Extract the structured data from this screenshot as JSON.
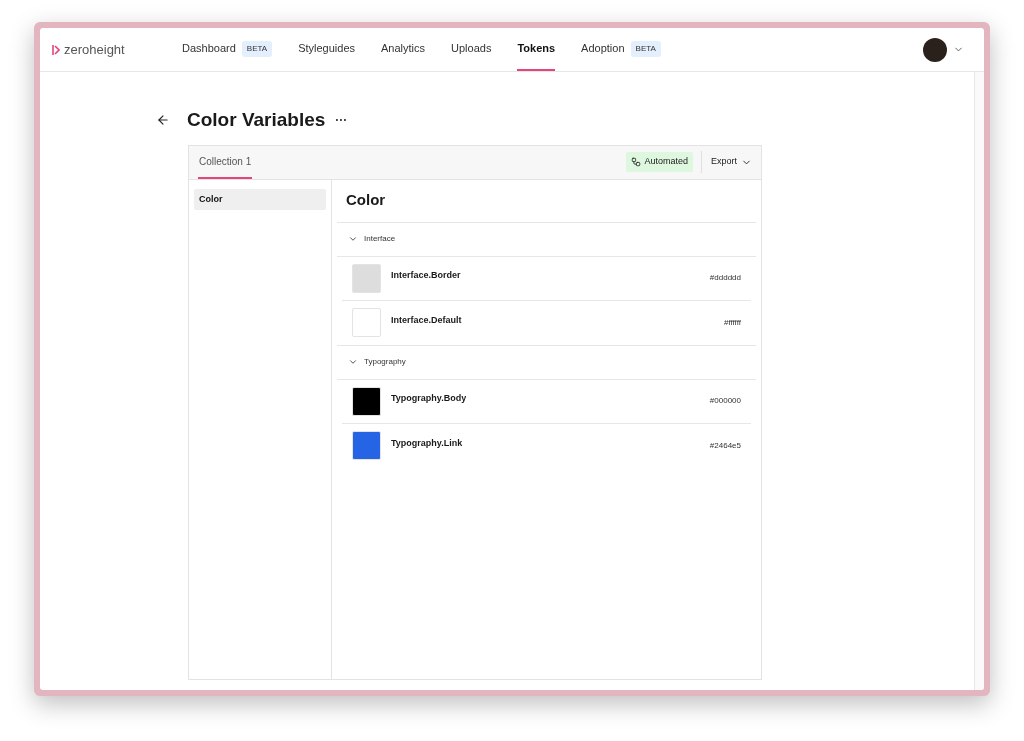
{
  "brand": "zeroheight",
  "nav": [
    {
      "label": "Dashboard",
      "badge": "BETA",
      "selected": false
    },
    {
      "label": "Styleguides",
      "selected": false
    },
    {
      "label": "Analytics",
      "selected": false
    },
    {
      "label": "Uploads",
      "selected": false
    },
    {
      "label": "Tokens",
      "selected": true
    },
    {
      "label": "Adoption",
      "badge": "BETA",
      "selected": false
    }
  ],
  "page_title": "Color Variables",
  "more": "···",
  "collection_tabs": [
    {
      "label": "Collection 1",
      "selected": true
    }
  ],
  "automated_badge": "Automated",
  "export_button": "Export",
  "sidebar": {
    "items": [
      {
        "label": "Color",
        "selected": true
      }
    ]
  },
  "section_title": "Color",
  "groups": [
    {
      "name": "Interface",
      "expanded": true,
      "tokens": [
        {
          "name": "Interface.Border",
          "value": "#dddddd",
          "color": "#dddddd"
        },
        {
          "name": "Interface.Default",
          "value": "#ffffff",
          "color": "#ffffff"
        }
      ]
    },
    {
      "name": "Typography",
      "expanded": true,
      "tokens": [
        {
          "name": "Typography.Body",
          "value": "#000000",
          "color": "#000000"
        },
        {
          "name": "Typography.Link",
          "value": "#2464e5",
          "color": "#2464e5"
        }
      ]
    }
  ]
}
